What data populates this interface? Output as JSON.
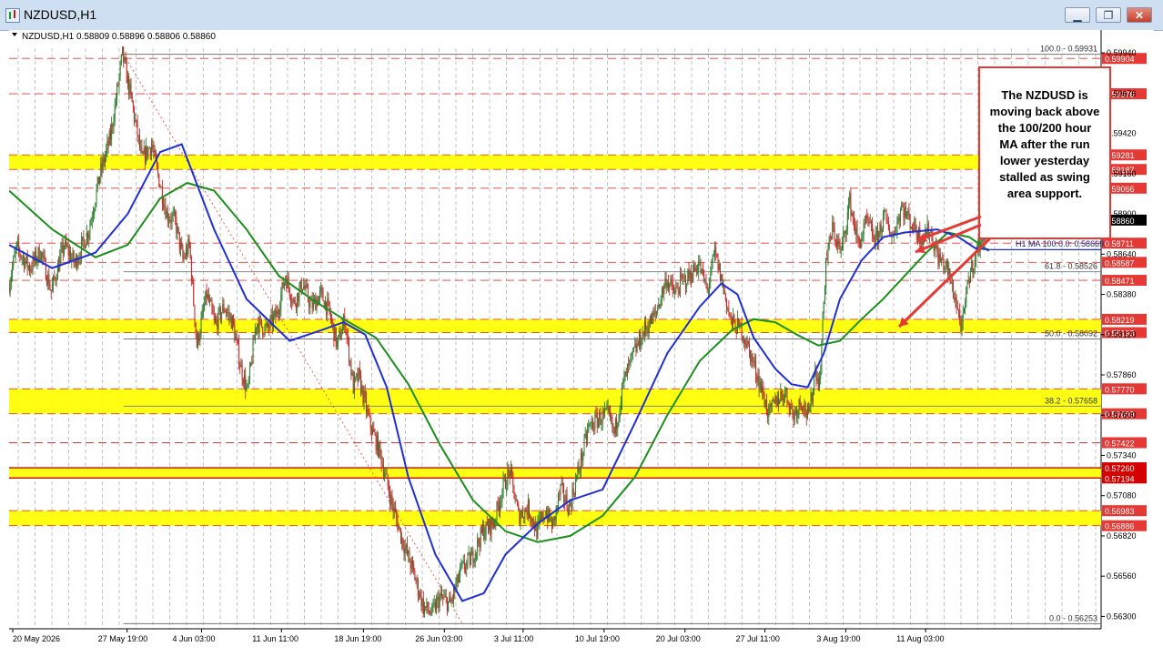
{
  "window": {
    "title": "NZDUSD,H1",
    "minimize_label": "▁",
    "restore_label": "❐",
    "close_label": "✕"
  },
  "chart_data": {
    "type": "candlestick",
    "symbol": "NZDUSD",
    "timeframe": "H1",
    "info_line": "NZDUSD,H1  0.58809 0.58896 0.58806 0.58860",
    "ylim": [
      0.5622,
      0.5997
    ],
    "current_price": "0.58860",
    "y_ticks": [
      "0.59940",
      "0.59676",
      "0.59420",
      "0.59160",
      "0.58900",
      "0.58640",
      "0.58380",
      "0.58120",
      "0.57860",
      "0.57600",
      "0.57340",
      "0.57080",
      "0.56820",
      "0.56560",
      "0.56300"
    ],
    "x_ticks": [
      {
        "t": 0,
        "label": "20 May 2026"
      },
      {
        "t": 106,
        "label": "27 May 19:00"
      },
      {
        "t": 175,
        "label": "4 Jun 03:00"
      },
      {
        "t": 249,
        "label": "11 Jun 11:00"
      },
      {
        "t": 325,
        "label": "18 Jun 19:00"
      },
      {
        "t": 400,
        "label": "26 Jun 03:00"
      },
      {
        "t": 473,
        "label": "3 Jul 11:00"
      },
      {
        "t": 548,
        "label": "10 Jul 19:00"
      },
      {
        "t": 623,
        "label": "20 Jul 03:00"
      },
      {
        "t": 697,
        "label": "27 Jul 11:00"
      },
      {
        "t": 772,
        "label": "3 Aug 19:00"
      },
      {
        "t": 846,
        "label": "11 Aug 03:00"
      }
    ],
    "horizontal_levels": [
      {
        "value": 0.59904,
        "label": "0.59904",
        "color": "#e53935"
      },
      {
        "value": 0.59676,
        "label": "0.59676",
        "color": "#e53935"
      },
      {
        "value": 0.59281,
        "label": "0.59281",
        "color": "#e53935"
      },
      {
        "value": 0.59187,
        "label": "0.59187",
        "color": "#e53935"
      },
      {
        "value": 0.59066,
        "label": "0.59066",
        "color": "#e53935"
      },
      {
        "value": 0.58711,
        "label": "0.58711",
        "color": "#e53935"
      },
      {
        "value": 0.58587,
        "label": "0.58587",
        "color": "#e53935"
      },
      {
        "value": 0.58471,
        "label": "0.58471",
        "color": "#e53935"
      },
      {
        "value": 0.58219,
        "label": "0.58219",
        "color": "#e53935"
      },
      {
        "value": 0.58133,
        "label": "0.58133",
        "color": "#e53935"
      },
      {
        "value": 0.5777,
        "label": "0.57770",
        "color": "#e53935"
      },
      {
        "value": 0.57609,
        "label": "0.57609",
        "color": "#e53935"
      },
      {
        "value": 0.57422,
        "label": "0.57422",
        "color": "#e53935"
      },
      {
        "value": 0.5726,
        "label": "0.57260",
        "color": "#d50000"
      },
      {
        "value": 0.57194,
        "label": "0.57194",
        "color": "#d50000"
      },
      {
        "value": 0.56983,
        "label": "0.56983",
        "color": "#e53935"
      },
      {
        "value": 0.56886,
        "label": "0.56886",
        "color": "#e53935"
      }
    ],
    "support_zones": [
      {
        "from": 0.59187,
        "to": 0.59281
      },
      {
        "from": 0.58133,
        "to": 0.58219
      },
      {
        "from": 0.57609,
        "to": 0.5777
      },
      {
        "from": 0.57194,
        "to": 0.5726
      },
      {
        "from": 0.56886,
        "to": 0.56983
      }
    ],
    "fibonacci": [
      {
        "value": 0.59931,
        "label": "100.0 - 0.59931"
      },
      {
        "value": 0.58526,
        "label": "61.8 - 0.58526"
      },
      {
        "value": 0.58092,
        "label": "50.0 - 0.58092"
      },
      {
        "value": 0.57658,
        "label": "38.2 - 0.57658"
      },
      {
        "value": 0.56253,
        "label": "0.0 - 0.56253"
      }
    ],
    "ma_label": "H1 MA 100:0.0: 0.58669",
    "ma_value": 0.58669,
    "annotation": "The NZDUSD is moving back above the 100/200 hour MA after the run lower yesterday stalled as swing area support.",
    "price_path": [
      [
        0,
        0.5842
      ],
      [
        8,
        0.5868
      ],
      [
        20,
        0.5855
      ],
      [
        30,
        0.5866
      ],
      [
        40,
        0.584
      ],
      [
        52,
        0.587
      ],
      [
        62,
        0.5858
      ],
      [
        75,
        0.588
      ],
      [
        85,
        0.5915
      ],
      [
        95,
        0.594
      ],
      [
        106,
        0.5993
      ],
      [
        114,
        0.5965
      ],
      [
        124,
        0.5925
      ],
      [
        133,
        0.5935
      ],
      [
        140,
        0.5912
      ],
      [
        147,
        0.589
      ],
      [
        155,
        0.5885
      ],
      [
        162,
        0.586
      ],
      [
        168,
        0.587
      ],
      [
        175,
        0.5805
      ],
      [
        184,
        0.5838
      ],
      [
        192,
        0.5818
      ],
      [
        200,
        0.583
      ],
      [
        208,
        0.582
      ],
      [
        216,
        0.579
      ],
      [
        222,
        0.5775
      ],
      [
        230,
        0.582
      ],
      [
        240,
        0.5815
      ],
      [
        249,
        0.5825
      ],
      [
        257,
        0.585
      ],
      [
        265,
        0.5832
      ],
      [
        273,
        0.5845
      ],
      [
        281,
        0.583
      ],
      [
        290,
        0.5838
      ],
      [
        297,
        0.5828
      ],
      [
        305,
        0.5805
      ],
      [
        312,
        0.5822
      ],
      [
        320,
        0.5778
      ],
      [
        325,
        0.5785
      ],
      [
        335,
        0.5755
      ],
      [
        345,
        0.5735
      ],
      [
        355,
        0.5705
      ],
      [
        365,
        0.568
      ],
      [
        375,
        0.566
      ],
      [
        385,
        0.5636
      ],
      [
        393,
        0.5632
      ],
      [
        400,
        0.5642
      ],
      [
        410,
        0.5638
      ],
      [
        420,
        0.566
      ],
      [
        430,
        0.5668
      ],
      [
        440,
        0.5685
      ],
      [
        450,
        0.569
      ],
      [
        458,
        0.5712
      ],
      [
        465,
        0.5724
      ],
      [
        473,
        0.5695
      ],
      [
        482,
        0.57
      ],
      [
        490,
        0.5685
      ],
      [
        498,
        0.5698
      ],
      [
        505,
        0.5688
      ],
      [
        512,
        0.5712
      ],
      [
        520,
        0.57
      ],
      [
        530,
        0.5728
      ],
      [
        538,
        0.5752
      ],
      [
        548,
        0.5758
      ],
      [
        556,
        0.576
      ],
      [
        562,
        0.5748
      ],
      [
        570,
        0.578
      ],
      [
        580,
        0.58
      ],
      [
        590,
        0.5815
      ],
      [
        600,
        0.5825
      ],
      [
        610,
        0.5848
      ],
      [
        618,
        0.5838
      ],
      [
        623,
        0.5845
      ],
      [
        632,
        0.585
      ],
      [
        640,
        0.5858
      ],
      [
        648,
        0.584
      ],
      [
        655,
        0.5865
      ],
      [
        662,
        0.5845
      ],
      [
        670,
        0.582
      ],
      [
        680,
        0.5815
      ],
      [
        690,
        0.5795
      ],
      [
        697,
        0.578
      ],
      [
        705,
        0.576
      ],
      [
        712,
        0.577
      ],
      [
        720,
        0.5775
      ],
      [
        728,
        0.576
      ],
      [
        735,
        0.577
      ],
      [
        742,
        0.5758
      ],
      [
        748,
        0.579
      ],
      [
        752,
        0.578
      ],
      [
        758,
        0.586
      ],
      [
        764,
        0.588
      ],
      [
        772,
        0.5865
      ],
      [
        780,
        0.5898
      ],
      [
        788,
        0.587
      ],
      [
        796,
        0.5885
      ],
      [
        804,
        0.5872
      ],
      [
        812,
        0.5888
      ],
      [
        820,
        0.5875
      ],
      [
        828,
        0.5895
      ],
      [
        836,
        0.5885
      ],
      [
        846,
        0.5875
      ],
      [
        854,
        0.588
      ],
      [
        862,
        0.5862
      ],
      [
        870,
        0.5855
      ],
      [
        878,
        0.5835
      ],
      [
        884,
        0.5815
      ],
      [
        890,
        0.5848
      ],
      [
        896,
        0.5862
      ],
      [
        902,
        0.5875
      ],
      [
        908,
        0.5886
      ]
    ],
    "ma100_blue": [
      [
        0,
        0.587
      ],
      [
        40,
        0.5855
      ],
      [
        80,
        0.5865
      ],
      [
        110,
        0.589
      ],
      [
        140,
        0.593
      ],
      [
        160,
        0.5935
      ],
      [
        190,
        0.588
      ],
      [
        220,
        0.5835
      ],
      [
        260,
        0.5808
      ],
      [
        290,
        0.5815
      ],
      [
        310,
        0.582
      ],
      [
        330,
        0.5812
      ],
      [
        350,
        0.5778
      ],
      [
        370,
        0.572
      ],
      [
        395,
        0.567
      ],
      [
        420,
        0.564
      ],
      [
        440,
        0.5645
      ],
      [
        460,
        0.567
      ],
      [
        490,
        0.569
      ],
      [
        520,
        0.5705
      ],
      [
        550,
        0.5712
      ],
      [
        580,
        0.5755
      ],
      [
        610,
        0.58
      ],
      [
        640,
        0.583
      ],
      [
        660,
        0.5845
      ],
      [
        675,
        0.5838
      ],
      [
        690,
        0.581
      ],
      [
        710,
        0.579
      ],
      [
        725,
        0.578
      ],
      [
        740,
        0.5778
      ],
      [
        755,
        0.58
      ],
      [
        770,
        0.5835
      ],
      [
        790,
        0.586
      ],
      [
        810,
        0.5875
      ],
      [
        830,
        0.5878
      ],
      [
        860,
        0.588
      ],
      [
        880,
        0.5875
      ],
      [
        895,
        0.5868
      ],
      [
        908,
        0.58669
      ]
    ],
    "ma200_green": [
      [
        0,
        0.5905
      ],
      [
        40,
        0.588
      ],
      [
        80,
        0.5862
      ],
      [
        110,
        0.587
      ],
      [
        140,
        0.59
      ],
      [
        165,
        0.591
      ],
      [
        190,
        0.5905
      ],
      [
        220,
        0.588
      ],
      [
        250,
        0.585
      ],
      [
        280,
        0.5835
      ],
      [
        310,
        0.5822
      ],
      [
        340,
        0.581
      ],
      [
        370,
        0.578
      ],
      [
        400,
        0.574
      ],
      [
        430,
        0.5705
      ],
      [
        460,
        0.5685
      ],
      [
        490,
        0.5678
      ],
      [
        520,
        0.5682
      ],
      [
        550,
        0.5695
      ],
      [
        580,
        0.572
      ],
      [
        610,
        0.576
      ],
      [
        640,
        0.5795
      ],
      [
        670,
        0.5815
      ],
      [
        690,
        0.5822
      ],
      [
        710,
        0.582
      ],
      [
        730,
        0.5812
      ],
      [
        750,
        0.5805
      ],
      [
        770,
        0.5808
      ],
      [
        790,
        0.5822
      ],
      [
        810,
        0.5835
      ],
      [
        830,
        0.585
      ],
      [
        850,
        0.5865
      ],
      [
        870,
        0.5878
      ],
      [
        890,
        0.5875
      ],
      [
        908,
        0.5866
      ]
    ]
  }
}
